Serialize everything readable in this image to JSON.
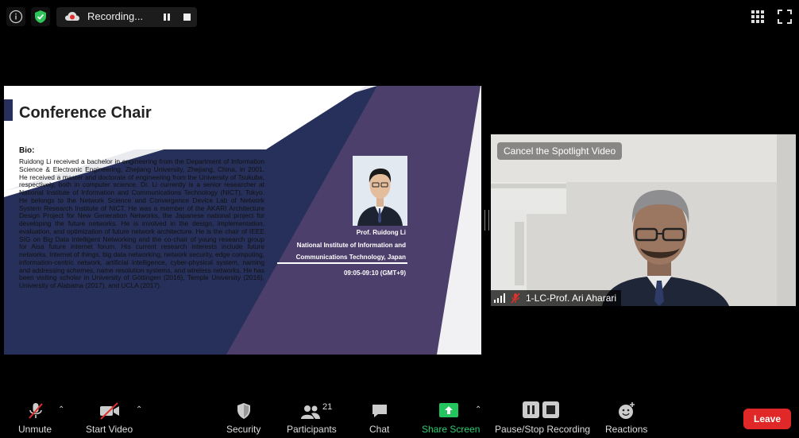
{
  "top_bar": {
    "info_icon": "info-icon",
    "security_icon": "shield-check-icon",
    "recording_label": "Recording...",
    "pause_icon": "pause-icon",
    "stop_icon": "stop-icon",
    "gallery_icon": "grid-view-icon",
    "fullscreen_icon": "fullscreen-icon"
  },
  "shared_slide": {
    "title": "Conference Chair",
    "bio_label": "Bio:",
    "bio_text": "Ruidong Li received a bachelor in engineering from the Department of Information Science & Electronic Engineering, Zhejiang University, Zhejiang, China, in 2001. He received a master and doctorate of engineering from the University of Tsukuba, respectively, both in computer science. Dr. Li currently is a senior researcher at National Institute of Information and Communications Technology (NICT), Tokyo. He belongs to the Network Science and Convergence Device Lab of Network System Research Institute of NICT. He was a member of the AKARI Architecture Design Project for New Generation Networks, the Japanese national project for developing the future networks. He is involved in the design, implementation, evaluation, and optimization of future network architecture. He is the chair of IEEE SIG on Big Data Intelligent Networking and the co-chair of young research group for Aisa future internet forum. His current research interests include future networks, Internet of things, big data networking, network security, edge computing, information-centric network, artificial intelligence, cyber-physical system, naming and addressing schemes, name resolution systems, and wireless networks. He has been visiting scholar in University of Göttingen (2016), Temple University (2016), University of Alabama (2017), and UCLA (2017).",
    "speaker_name": "Prof. Ruidong Li",
    "affiliation_line1": "National Institute of Information and",
    "affiliation_line2": "Communications Technology, Japan",
    "time_slot": "09:05-09:10 (GMT+9)"
  },
  "spotlight_video": {
    "cancel_spotlight_label": "Cancel the Spotlight Video",
    "participant_name": "1-LC-Prof. Ari Aharari",
    "signal_icon": "signal-bars-icon",
    "muted_icon": "mic-muted-icon"
  },
  "toolbar": {
    "unmute_label": "Unmute",
    "start_video_label": "Start Video",
    "security_label": "Security",
    "participants_label": "Participants",
    "participants_count": "21",
    "chat_label": "Chat",
    "share_screen_label": "Share Screen",
    "pause_stop_recording_label": "Pause/Stop Recording",
    "reactions_label": "Reactions",
    "leave_label": "Leave",
    "share_color": "#22c55e",
    "leave_color": "#e02828"
  }
}
